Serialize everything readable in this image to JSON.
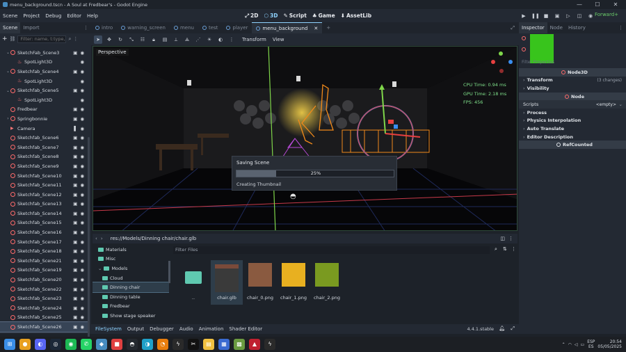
{
  "window": {
    "title": "menu_background.tscn - A Soul at Fredbear's - Godot Engine",
    "minimize": "—",
    "maximize": "☐",
    "close": "✕"
  },
  "menubar": {
    "items": [
      "Scene",
      "Project",
      "Debug",
      "Editor",
      "Help"
    ],
    "modes": [
      {
        "label": "2D",
        "icon": "2d-icon"
      },
      {
        "label": "3D",
        "icon": "3d-icon",
        "active": true
      },
      {
        "label": "Script",
        "icon": "script-icon"
      },
      {
        "label": "Game",
        "icon": "game-icon"
      },
      {
        "label": "AssetLib",
        "icon": "assetlib-icon"
      }
    ],
    "renderer": "Forward+"
  },
  "scene_dock": {
    "tabs": [
      "Scene",
      "Import"
    ],
    "filter_placeholder": "Filter: name, t:type, g:g",
    "nodes": [
      {
        "label": "SketchFab_Scene3",
        "type": "node3d",
        "icons": [
          "▣",
          "◉"
        ]
      },
      {
        "label": "SpotLight3D",
        "type": "spotlight",
        "icons": [
          "◉"
        ]
      },
      {
        "label": "Sketchfab_Scene4",
        "type": "node3d",
        "icons": [
          "▣",
          "◉"
        ]
      },
      {
        "label": "SpotLight3D",
        "type": "spotlight",
        "icons": [
          "◉"
        ]
      },
      {
        "label": "Sketchfab_Scene5",
        "type": "node3d",
        "icons": [
          "▣",
          "◉"
        ]
      },
      {
        "label": "SpotLight3D",
        "type": "spotlight",
        "icons": [
          "◉"
        ]
      },
      {
        "label": "Fredbear",
        "type": "node3d",
        "icons": [
          "▣",
          "◉"
        ]
      },
      {
        "label": "Springbonnie",
        "type": "node3d",
        "icons": [
          "▣",
          "◉"
        ]
      },
      {
        "label": "Camera",
        "type": "camera",
        "icons": [
          "▌",
          "◉"
        ]
      },
      {
        "label": "Sketchfab_Scene6",
        "type": "node3d",
        "icons": [
          "▣",
          "◉"
        ]
      },
      {
        "label": "Sketchfab_Scene7",
        "type": "node3d",
        "icons": [
          "▣",
          "◉"
        ]
      },
      {
        "label": "Sketchfab_Scene8",
        "type": "node3d",
        "icons": [
          "▣",
          "◉"
        ]
      },
      {
        "label": "Sketchfab_Scene9",
        "type": "node3d",
        "icons": [
          "▣",
          "◉"
        ]
      },
      {
        "label": "Sketchfab_Scene10",
        "type": "node3d",
        "icons": [
          "▣",
          "◉"
        ]
      },
      {
        "label": "Sketchfab_Scene11",
        "type": "node3d",
        "icons": [
          "▣",
          "◉"
        ]
      },
      {
        "label": "Sketchfab_Scene12",
        "type": "node3d",
        "icons": [
          "▣",
          "◉"
        ]
      },
      {
        "label": "Sketchfab_Scene13",
        "type": "node3d",
        "icons": [
          "▣",
          "◉"
        ]
      },
      {
        "label": "Sketchfab_Scene14",
        "type": "node3d",
        "icons": [
          "▣",
          "◉"
        ]
      },
      {
        "label": "Sketchfab_Scene15",
        "type": "node3d",
        "icons": [
          "▣",
          "◉"
        ]
      },
      {
        "label": "Sketchfab_Scene16",
        "type": "node3d",
        "icons": [
          "▣",
          "◉"
        ]
      },
      {
        "label": "Sketchfab_Scene17",
        "type": "node3d",
        "icons": [
          "▣",
          "◉"
        ]
      },
      {
        "label": "Sketchfab_Scene18",
        "type": "node3d",
        "icons": [
          "▣",
          "◉"
        ]
      },
      {
        "label": "Sketchfab_Scene21",
        "type": "node3d",
        "icons": [
          "▣",
          "◉"
        ]
      },
      {
        "label": "Sketchfab_Scene19",
        "type": "node3d",
        "icons": [
          "▣",
          "◉"
        ]
      },
      {
        "label": "Sketchfab_Scene20",
        "type": "node3d",
        "icons": [
          "▣",
          "◉"
        ]
      },
      {
        "label": "Sketchfab_Scene22",
        "type": "node3d",
        "icons": [
          "▣",
          "◉"
        ]
      },
      {
        "label": "Sketchfab_Scene23",
        "type": "node3d",
        "icons": [
          "▣",
          "◉"
        ]
      },
      {
        "label": "Sketchfab_Scene24",
        "type": "node3d",
        "icons": [
          "▣",
          "◉"
        ]
      },
      {
        "label": "Sketchfab_Scene25",
        "type": "node3d",
        "icons": [
          "▣",
          "◉"
        ]
      },
      {
        "label": "Sketchfab_Scene26",
        "type": "node3d",
        "icons": [
          "▣",
          "◉"
        ],
        "selected": true
      }
    ]
  },
  "scene_tabs": [
    {
      "label": "intro"
    },
    {
      "label": "warning_screen"
    },
    {
      "label": "menu"
    },
    {
      "label": "test"
    },
    {
      "label": "player"
    },
    {
      "label": "menu_background",
      "active": true,
      "close": "✕"
    }
  ],
  "new_tab": "+",
  "toolbar": {
    "menus": [
      "Transform",
      "View"
    ]
  },
  "viewport": {
    "label": "Perspective",
    "perf": [
      "CPU Time: 0.94 ms",
      "GPU Time: 2.18 ms",
      "FPS: 456"
    ],
    "gizmo_axes": [
      "Y",
      "X",
      "Z"
    ]
  },
  "save_dialog": {
    "title": "Saving Scene",
    "progress_percent": 25,
    "progress_label": "25%",
    "status": "Creating Thumbnail"
  },
  "filesystem": {
    "path": "res://Models/Dinning chair/chair.glb",
    "tree": [
      {
        "label": "Materials",
        "depth": 1
      },
      {
        "label": "Misc",
        "depth": 1
      },
      {
        "label": "Models",
        "depth": 1,
        "expanded": true
      },
      {
        "label": "Cloud",
        "depth": 2
      },
      {
        "label": "Dinning chair",
        "depth": 2,
        "selected": true
      },
      {
        "label": "Dinning table",
        "depth": 2
      },
      {
        "label": "Fredbear",
        "depth": 2
      },
      {
        "label": "Show stage speaker",
        "depth": 2
      }
    ],
    "filter_placeholder": "Filter Files",
    "files": [
      {
        "label": "..",
        "kind": "folder"
      },
      {
        "label": "chair.glb",
        "kind": "model",
        "selected": true,
        "color": "#7a4a3a"
      },
      {
        "label": "chair_0.png",
        "kind": "texture",
        "color": "#8a5a40"
      },
      {
        "label": "chair_1.png",
        "kind": "texture",
        "color": "#e8b020"
      },
      {
        "label": "chair_2.png",
        "kind": "texture",
        "color": "#7a9a20"
      }
    ]
  },
  "bottom_panel": {
    "tabs": [
      "FileSystem",
      "Output",
      "Debugger",
      "Audio",
      "Animation",
      "Shader Editor"
    ],
    "version": "4.4.1.stable"
  },
  "inspector": {
    "tabs": [
      "Inspector",
      "Node",
      "History"
    ],
    "filter_placeholder": "Filter Properties",
    "class_header": "Node3D",
    "sections": [
      {
        "label": "Transform",
        "value": "(3 changes)"
      },
      {
        "label": "Visibility",
        "value": ""
      }
    ],
    "node_header": "Node",
    "scripts_label": "Scripts",
    "scripts_value": "<empty>",
    "node_sections": [
      "Process",
      "Physics Interpolation",
      "Auto Translate",
      "Editor Description"
    ],
    "refcounted": "RefCounted"
  },
  "taskbar": {
    "apps": [
      {
        "name": "windows-start-icon",
        "color": "#3a8ee6",
        "glyph": "⊞"
      },
      {
        "name": "chrome-icon",
        "color": "#e8a020",
        "glyph": "●"
      },
      {
        "name": "discord-icon",
        "color": "#5865f2",
        "glyph": "◐"
      },
      {
        "name": "steam-icon",
        "color": "#1b2838",
        "glyph": "◎"
      },
      {
        "name": "spotify-icon",
        "color": "#1db954",
        "glyph": "◉"
      },
      {
        "name": "whatsapp-icon",
        "color": "#25d366",
        "glyph": "✆"
      },
      {
        "name": "godot-icon",
        "color": "#478cbf",
        "glyph": "◆"
      },
      {
        "name": "app-icon",
        "color": "#e04040",
        "glyph": "■"
      },
      {
        "name": "github-icon",
        "color": "#24292f",
        "glyph": "◓"
      },
      {
        "name": "edge-icon",
        "color": "#1fa0c8",
        "glyph": "◑"
      },
      {
        "name": "blender-icon",
        "color": "#e87d0d",
        "glyph": "◔"
      },
      {
        "name": "godot-alt-icon",
        "color": "#2a2a2a",
        "glyph": "ϟ"
      },
      {
        "name": "capcut-icon",
        "color": "#111111",
        "glyph": "✂"
      },
      {
        "name": "explorer-icon",
        "color": "#f0c040",
        "glyph": "▤"
      },
      {
        "name": "store-icon",
        "color": "#3a6ad0",
        "glyph": "▦"
      },
      {
        "name": "minecraft-icon",
        "color": "#6a9a40",
        "glyph": "▩"
      },
      {
        "name": "game-app-icon",
        "color": "#c02030",
        "glyph": "▲"
      },
      {
        "name": "godot-editor-icon",
        "color": "#2a2a2a",
        "glyph": "ϟ"
      }
    ],
    "lang": "ESP",
    "lang_sub": "ES",
    "time": "20:54",
    "date": "05/05/2025"
  },
  "colors": {
    "accent": "#8fd3ff",
    "node_red": "#ff6b6b",
    "fps_green": "#7fe08a",
    "folder": "#5fc9b0"
  }
}
